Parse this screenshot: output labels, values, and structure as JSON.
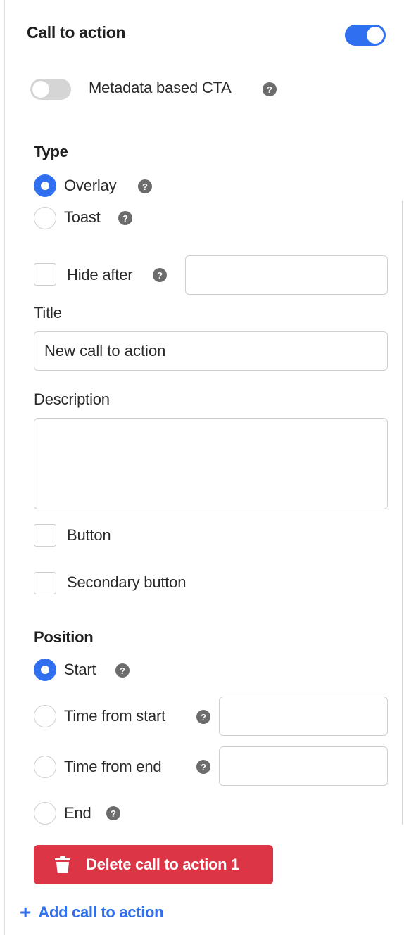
{
  "header": {
    "title": "Call to action",
    "enabled": true
  },
  "metadata_toggle": {
    "label": "Metadata based CTA",
    "enabled": false
  },
  "type_section": {
    "title": "Type",
    "options": [
      {
        "label": "Overlay",
        "checked": true
      },
      {
        "label": "Toast",
        "checked": false
      }
    ]
  },
  "hide_after": {
    "label": "Hide after",
    "checked": false,
    "value": ""
  },
  "title_field": {
    "label": "Title",
    "value": "New call to action"
  },
  "description_field": {
    "label": "Description",
    "value": ""
  },
  "button_option": {
    "label": "Button",
    "checked": false
  },
  "secondary_button_option": {
    "label": "Secondary button",
    "checked": false
  },
  "position_section": {
    "title": "Position",
    "options": [
      {
        "label": "Start",
        "checked": true
      },
      {
        "label": "Time from start",
        "checked": false,
        "value": ""
      },
      {
        "label": "Time from end",
        "checked": false,
        "value": ""
      },
      {
        "label": "End",
        "checked": false
      }
    ]
  },
  "help_glyph": "?",
  "delete_button": {
    "label": "Delete call to action 1",
    "icon": "trash-icon"
  },
  "add_link": {
    "plus": "+",
    "label": "Add call to action"
  },
  "colors": {
    "accent": "#2f6ff0",
    "danger": "#dc3545"
  }
}
